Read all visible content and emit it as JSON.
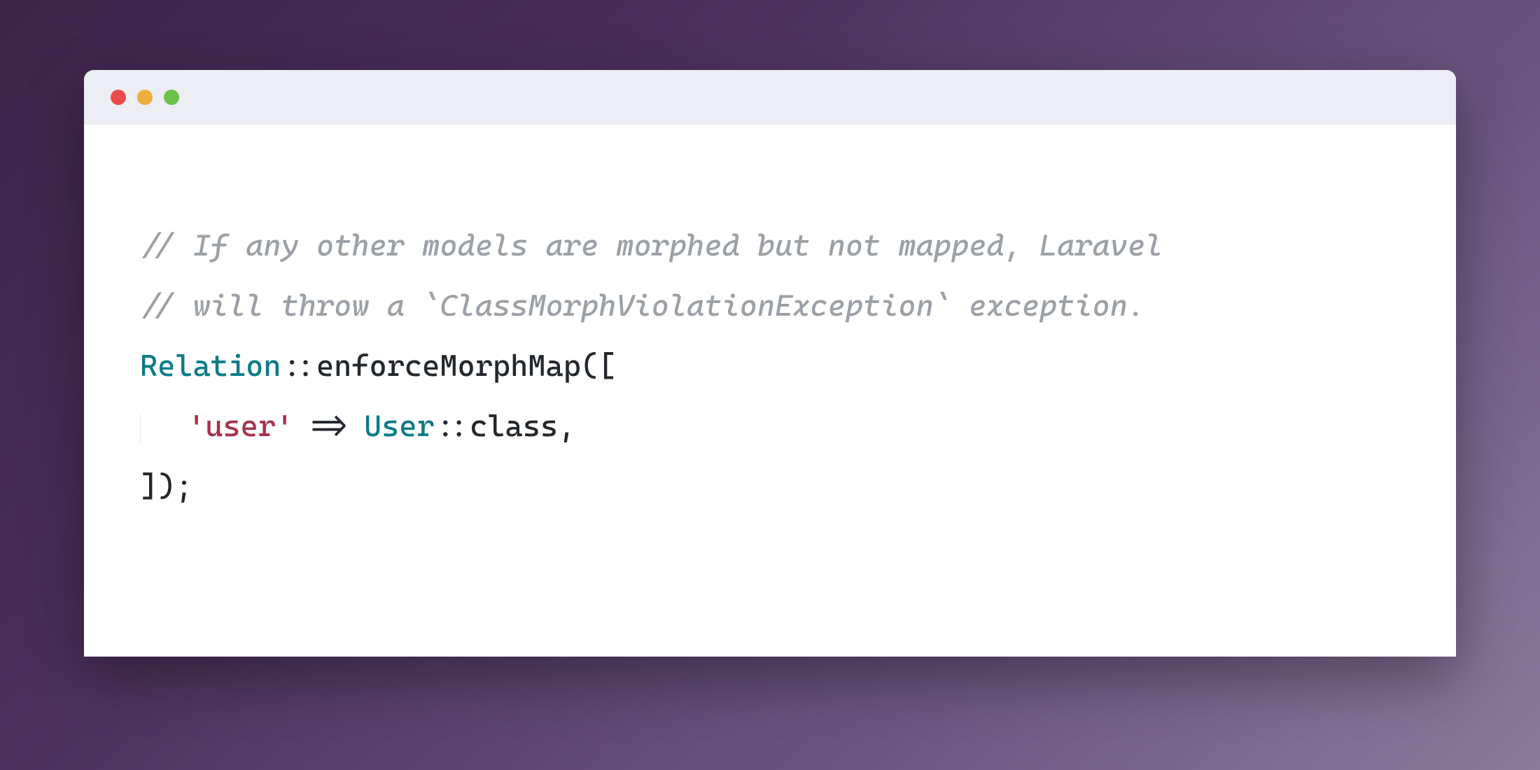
{
  "code": {
    "comment1": "// If any other models are morphed but not mapped, Laravel",
    "comment2": "// will throw a `ClassMorphViolationException` exception.",
    "line3": {
      "class": "Relation",
      "dbl": "::",
      "method": "enforceMorphMap",
      "open": "(["
    },
    "line4": {
      "string": "'user'",
      "arrow": " => ",
      "classref": "User",
      "dbl": "::",
      "prop": "class",
      "comma": ","
    },
    "line5": "]);"
  },
  "colors": {
    "bg_gradient_start": "#3d2449",
    "bg_gradient_end": "#8b7a9c",
    "titlebar": "#eceef3",
    "red": "#e94b4a",
    "yellow": "#edae3c",
    "green": "#6cc247",
    "comment": "#9ca1a8",
    "classname": "#0e7c86",
    "string": "#a6344b",
    "default": "#23272e"
  }
}
